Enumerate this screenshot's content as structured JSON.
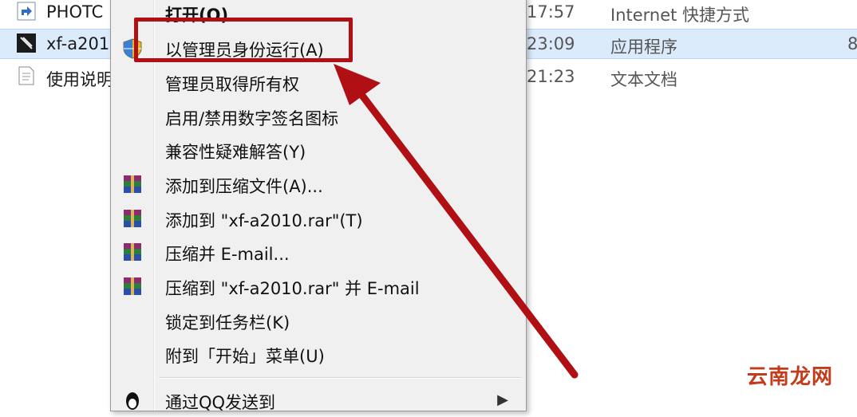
{
  "files": [
    {
      "name": "PHOTC",
      "time": "17:57",
      "type": "Internet 快捷方式",
      "size": "",
      "icon": "shortcut-icon",
      "selected": false
    },
    {
      "name": "xf-a201",
      "time": "23:09",
      "type": "应用程序",
      "size": "8",
      "icon": "app-icon",
      "selected": true
    },
    {
      "name": "使用说明",
      "time": "21:23",
      "type": "文本文档",
      "size": "",
      "icon": "text-file-icon",
      "selected": false
    }
  ],
  "menu": {
    "items": [
      {
        "label": "打开(O)",
        "bold": true,
        "icon": ""
      },
      {
        "label": "以管理员身份运行(A)",
        "icon": "uac-shield-icon"
      },
      {
        "label": "管理员取得所有权",
        "icon": ""
      },
      {
        "label": "启用/禁用数字签名图标",
        "icon": ""
      },
      {
        "label": "兼容性疑难解答(Y)",
        "icon": ""
      },
      {
        "label": "添加到压缩文件(A)...",
        "icon": "winrar-icon"
      },
      {
        "label": "添加到 \"xf-a2010.rar\"(T)",
        "icon": "winrar-icon"
      },
      {
        "label": "压缩并 E-mail...",
        "icon": "winrar-icon"
      },
      {
        "label": "压缩到 \"xf-a2010.rar\" 并 E-mail",
        "icon": "winrar-icon"
      },
      {
        "label": "锁定到任务栏(K)",
        "icon": ""
      },
      {
        "label": "附到「开始」菜单(U)",
        "icon": ""
      },
      {
        "label": "通过QQ发送到",
        "icon": "qq-icon",
        "has_submenu": true
      }
    ]
  },
  "watermark": "云南龙网",
  "colors": {
    "annotation_red": "#b00f13",
    "selection_blue": "#dcebfc"
  }
}
